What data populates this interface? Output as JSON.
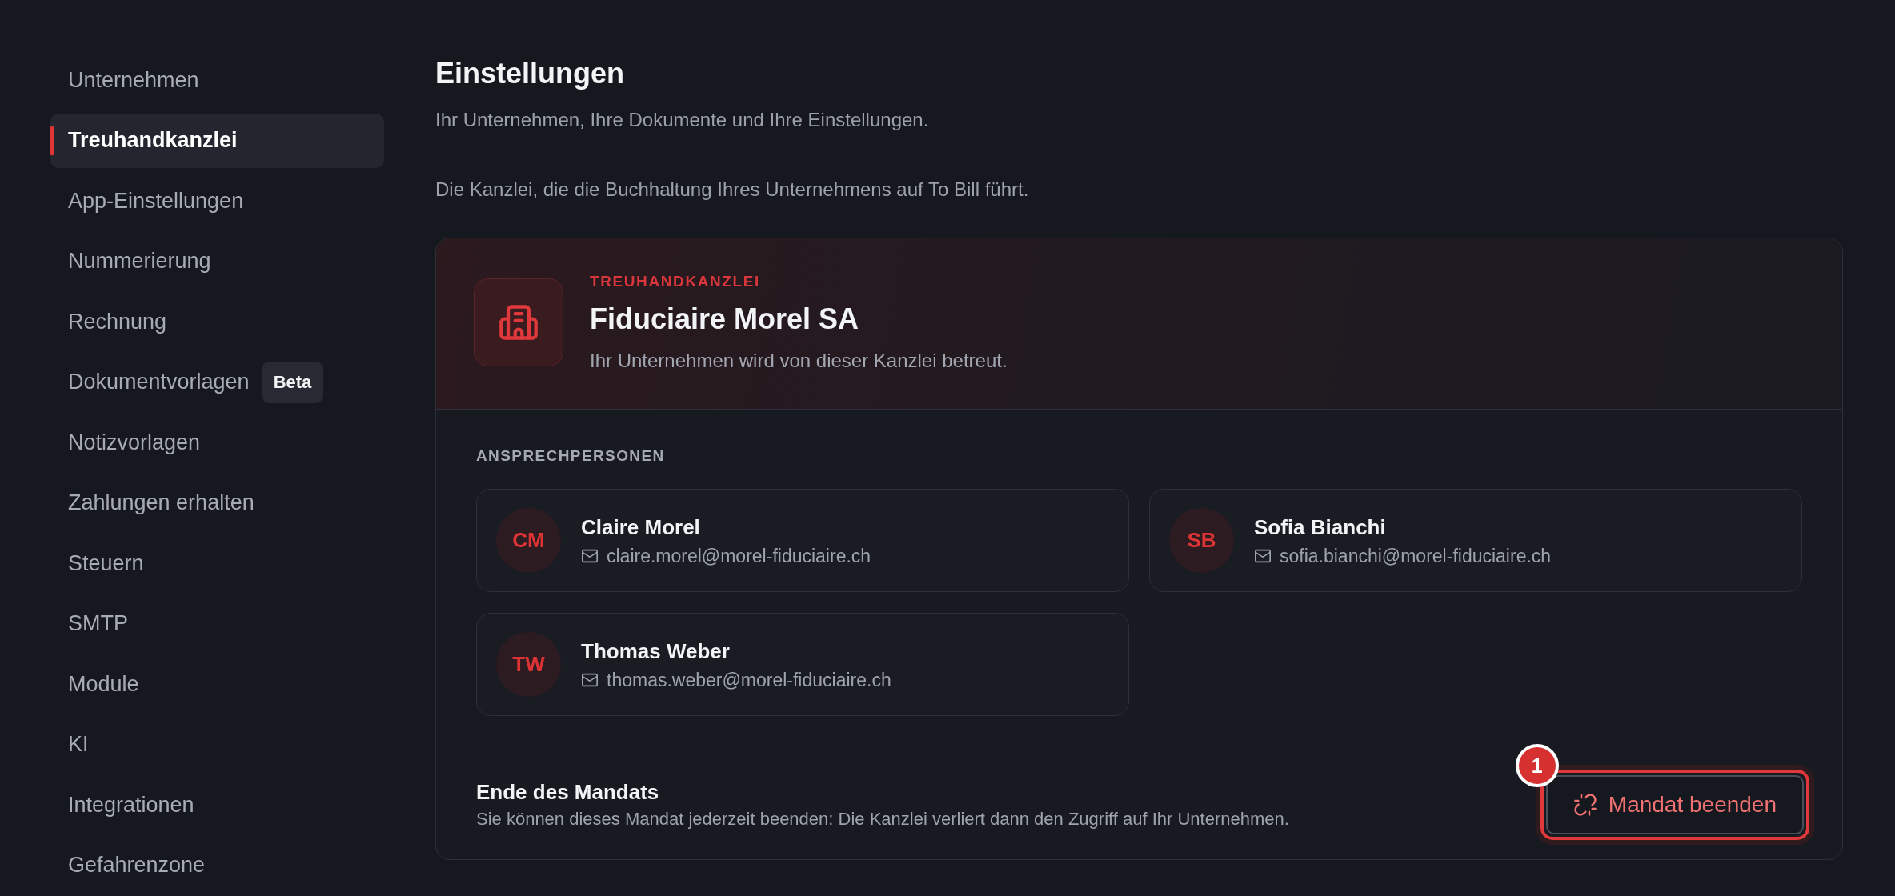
{
  "sidebar": {
    "items": [
      {
        "label": "Unternehmen",
        "selected": false
      },
      {
        "label": "Treuhandkanzlei",
        "selected": true
      },
      {
        "label": "App-Einstellungen",
        "selected": false
      },
      {
        "label": "Nummerierung",
        "selected": false
      },
      {
        "label": "Rechnung",
        "selected": false
      },
      {
        "label": "Dokumentvorlagen",
        "selected": false,
        "badge": "Beta"
      },
      {
        "label": "Notizvorlagen",
        "selected": false
      },
      {
        "label": "Zahlungen erhalten",
        "selected": false
      },
      {
        "label": "Steuern",
        "selected": false
      },
      {
        "label": "SMTP",
        "selected": false
      },
      {
        "label": "Module",
        "selected": false
      },
      {
        "label": "KI",
        "selected": false
      },
      {
        "label": "Integrationen",
        "selected": false
      },
      {
        "label": "Gefahrenzone",
        "selected": false
      }
    ]
  },
  "page": {
    "title": "Einstellungen",
    "subtitle": "Ihr Unternehmen, Ihre Dokumente und Ihre Einstellungen.",
    "description": "Die Kanzlei, die die Buchhaltung Ihres Unternehmens auf To Bill führt."
  },
  "firm_card": {
    "eyebrow": "TREUHANDKANZLEI",
    "name": "Fiduciaire Morel SA",
    "note": "Ihr Unternehmen wird von dieser Kanzlei betreut.",
    "contacts_heading": "ANSPRECHPERSONEN",
    "contacts": [
      {
        "initials": "CM",
        "name": "Claire Morel",
        "email": "claire.morel@morel-fiduciaire.ch"
      },
      {
        "initials": "SB",
        "name": "Sofia Bianchi",
        "email": "sofia.bianchi@morel-fiduciaire.ch"
      },
      {
        "initials": "TW",
        "name": "Thomas Weber",
        "email": "thomas.weber@morel-fiduciaire.ch"
      }
    ],
    "footer": {
      "title": "Ende des Mandats",
      "text": "Sie können dieses Mandat jederzeit beenden: Die Kanzlei verliert dann den Zugriff auf Ihr Unternehmen.",
      "button": {
        "label": "Mandat beenden",
        "highlighted": true,
        "marker": "1"
      }
    }
  }
}
